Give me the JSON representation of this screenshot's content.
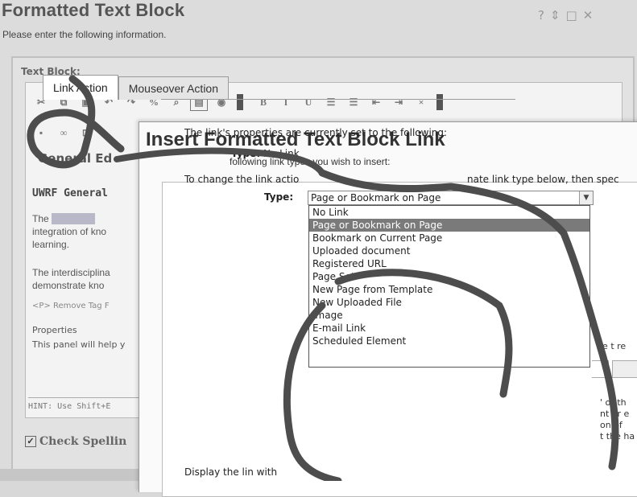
{
  "background": {
    "title": "Formatted Text Block",
    "subtitle": "Please enter the following information.",
    "field_label": "Text Block:",
    "section_heading": "General Ed",
    "bold_line": "UWRF General",
    "para1": [
      "The",
      "integration of kno",
      "learning."
    ],
    "para2": [
      "The interdisciplina",
      "demonstrate kno"
    ],
    "tag_bar": "<P>  Remove Tag  F",
    "props_title": "Properties",
    "props_desc": "This panel will help y",
    "hint": "HINT: Use Shift+E",
    "check_label": "Check Spellin"
  },
  "dialog": {
    "title": "Insert Formatted Text Block Link",
    "subtitle": "following link types you wish to insert:",
    "tabs": [
      {
        "label": "Link Action",
        "active": true
      },
      {
        "label": "Mouseover Action",
        "active": false
      }
    ],
    "props_text": "The link's properties are currently set to the following:",
    "current_type_label": "Type:",
    "current_type_value": "No Link",
    "change_text_a": "To change the link actio",
    "change_text_b": "nate link type below, then spec",
    "type_label": "Type:",
    "select_value": "Page or Bookmark on Page",
    "options": [
      "No Link",
      "Page or Bookmark on Page",
      "Bookmark on Current Page",
      "Uploaded document",
      "Registered URL",
      "Page Set",
      "New Page from Template",
      "New Uploaded File",
      "Image",
      "E-mail Link",
      "Scheduled Element"
    ],
    "selected_index": 1,
    "display_label": "Display the lin",
    "display_label_tail": "with",
    "right_fragments": [
      "le t re",
      "' or th",
      "nt or e",
      "on of",
      "t the ha"
    ]
  },
  "colors": {
    "annotation": "#4d4d4d",
    "selected_option": "#7a7a7a"
  }
}
